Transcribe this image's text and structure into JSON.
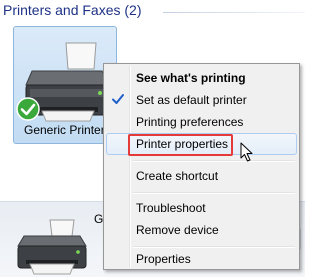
{
  "group": {
    "title": "Printers and Faxes (2)"
  },
  "device": {
    "name_visible": "Generic Printer",
    "icon": "printer-icon",
    "status_icon": "green-checkmark-icon"
  },
  "lower": {
    "label_partial": "G",
    "icon": "printer-icon"
  },
  "context_menu": {
    "items": [
      {
        "label": "See what's printing",
        "bold": true
      },
      {
        "label": "Set as default printer",
        "checked": true
      },
      {
        "label": "Printing preferences"
      },
      {
        "label": "Printer properties",
        "highlighted": true
      },
      {
        "label": "Create shortcut"
      },
      {
        "label": "Troubleshoot"
      },
      {
        "label": "Remove device"
      },
      {
        "label": "Properties"
      }
    ]
  },
  "colors": {
    "header_text": "#1e3287",
    "selection_fill": "#c9e0f7",
    "annotation_red": "#e43a3a",
    "check_blue": "#1f5fc9"
  }
}
